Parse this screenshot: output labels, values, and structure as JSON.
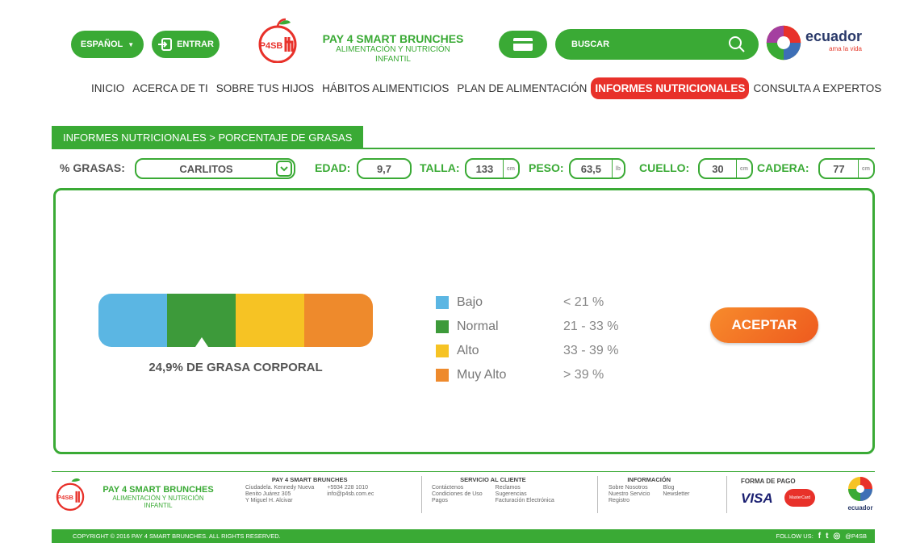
{
  "header": {
    "lang_label": "ESPAÑOL",
    "login_label": "ENTRAR",
    "logo_text": "P4SB",
    "brand_title": "PAY 4 SMART BRUNCHES",
    "brand_sub_1": "ALIMENTACIÓN Y NUTRICIÓN",
    "brand_sub_2": "INFANTIL",
    "search_placeholder": "BUSCAR",
    "ecuador_text": "ecuador",
    "ecuador_sub": "ama la vida"
  },
  "nav": {
    "items": [
      "INICIO",
      "ACERCA DE TI",
      "SOBRE TUS HIJOS",
      "HÁBITOS ALIMENTICIOS",
      "PLAN DE ALIMENTACIÓN",
      "INFORMES NUTRICIONALES",
      "CONSULTA A EXPERTOS"
    ],
    "active_index": 5
  },
  "breadcrumb": "INFORMES NUTRICIONALES > PORCENTAJE DE GRASAS",
  "form": {
    "grasas_label": "% GRASAS:",
    "child_name": "CARLITOS",
    "edad_label": "EDAD:",
    "edad_value": "9,7",
    "talla_label": "TALLA:",
    "talla_value": "133",
    "talla_unit": "cm",
    "peso_label": "PESO:",
    "peso_value": "63,5",
    "peso_unit": "lb",
    "cuello_label": "CUELLO:",
    "cuello_value": "30",
    "cuello_unit": "cm",
    "cadera_label": "CADERA:",
    "cadera_value": "77",
    "cadera_unit": "cm"
  },
  "result": {
    "text": "24,9% DE GRASA CORPORAL",
    "pointer_segment": 1
  },
  "legend": [
    {
      "name": "Bajo",
      "range": "< 21 %",
      "color": "#5bb6e3"
    },
    {
      "name": "Normal",
      "range": "21 - 33 %",
      "color": "#3d9a3a"
    },
    {
      "name": "Alto",
      "range": "33 - 39 %",
      "color": "#f6c324"
    },
    {
      "name": "Muy Alto",
      "range": "> 39 %",
      "color": "#ee8a2c"
    }
  ],
  "accept_label": "ACEPTAR",
  "footer": {
    "brand_title": "PAY 4 SMART BRUNCHES",
    "brand_sub_1": "ALIMENTACIÓN Y NUTRICIÓN",
    "brand_sub_2": "INFANTIL",
    "col1_heading": "PAY 4 SMART BRUNCHES",
    "col1": [
      "Ciudadela. Kennedy Nueva",
      "+5934 228 1010",
      "Benito Juárez 305",
      "info@p4sb.com.ec",
      "Y Miguel H. Alcivar",
      ""
    ],
    "col2_heading": "SERVICIO AL CLIENTE",
    "col2": [
      "Contáctenos",
      "Reclamos",
      "Condiciones de Uso",
      "Sugerencias",
      "Pagos",
      "Facturación Electrónica"
    ],
    "col3_heading": "INFORMACIÓN",
    "col3": [
      "Sobre Nosotros",
      "Blog",
      "Nuestro Servicio",
      "Newsletter",
      "Registro",
      ""
    ],
    "pay_heading": "FORMA DE PAGO",
    "visa": "VISA",
    "mastercard": "MasterCard",
    "copyright": "COPYRIGHT © 2016 PAY 4 SMART BRUNCHES. ALL RIGHTS RESERVED.",
    "follow": "FOLLOW US:",
    "handle": "@P4SB"
  },
  "colors": {
    "brand_green": "#3aaa35",
    "active_red": "#e8312a",
    "accept_orange": "#f0702a"
  }
}
